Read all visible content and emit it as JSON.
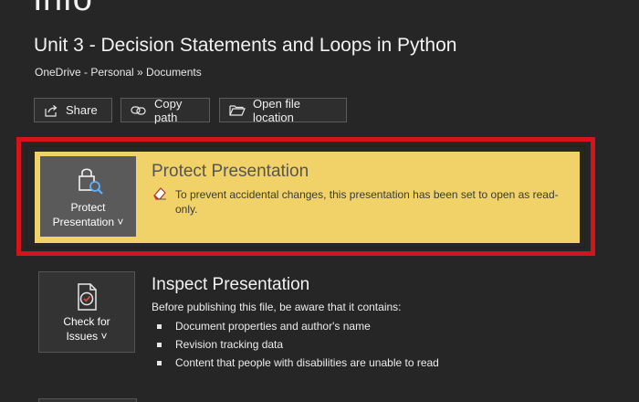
{
  "header": {
    "heading": "Info",
    "doc_title": "Unit 3 - Decision Statements and Loops in Python",
    "breadcrumb": "OneDrive - Personal » Documents"
  },
  "actions": {
    "share": "Share",
    "copy_path": "Copy path",
    "open_location": "Open file location"
  },
  "protect": {
    "tile_line1": "Protect",
    "tile_line2": "Presentation ˅",
    "title": "Protect Presentation",
    "message": "To prevent accidental changes, this presentation has been set to open as read-only.",
    "panel_color": "#f0d268",
    "highlight_color": "#d4141b"
  },
  "inspect": {
    "tile_line1": "Check for",
    "tile_line2": "Issues ˅",
    "title": "Inspect Presentation",
    "description": "Before publishing this file, be aware that it contains:",
    "items": [
      "Document properties and author's name",
      "Revision tracking data",
      "Content that people with disabilities are unable to read"
    ]
  },
  "icons": {
    "share": "share-icon",
    "copy_path": "link-icon",
    "open_location": "folder-icon",
    "protect": "lock-magnifier-icon",
    "message": "eraser-icon",
    "inspect": "document-check-icon"
  }
}
